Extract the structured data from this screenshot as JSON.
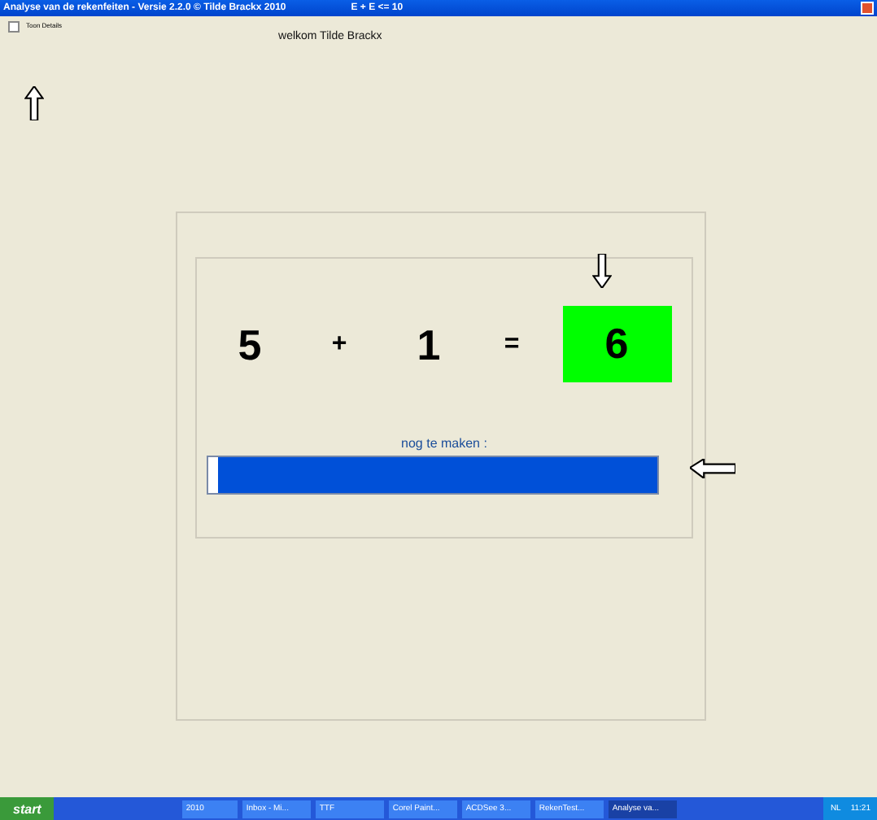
{
  "window": {
    "title": "Analyse van de rekenfeiten - Versie 2.2.0 © Tilde Brackx 2010",
    "subtitle": "E + E <= 10"
  },
  "toon_details": {
    "label": "Toon Details",
    "checked": false
  },
  "welcome": "welkom Tilde Brackx",
  "exercise": {
    "operand_1": "5",
    "operator": "+",
    "operand_2": "1",
    "equals": "=",
    "answer": "6"
  },
  "progress": {
    "label": "nog te maken :",
    "level": 0.98
  },
  "taskbar": {
    "start": "start",
    "buttons": [
      {
        "label": "2010",
        "active": false
      },
      {
        "label": "Inbox - Mi...",
        "active": false
      },
      {
        "label": "TTF",
        "active": false
      },
      {
        "label": "Corel Paint...",
        "active": false
      },
      {
        "label": "ACDSee 3...",
        "active": false
      },
      {
        "label": "RekenTest...",
        "active": false
      },
      {
        "label": "Analyse va...",
        "active": true
      }
    ],
    "language": "NL",
    "clock": "11:21"
  }
}
